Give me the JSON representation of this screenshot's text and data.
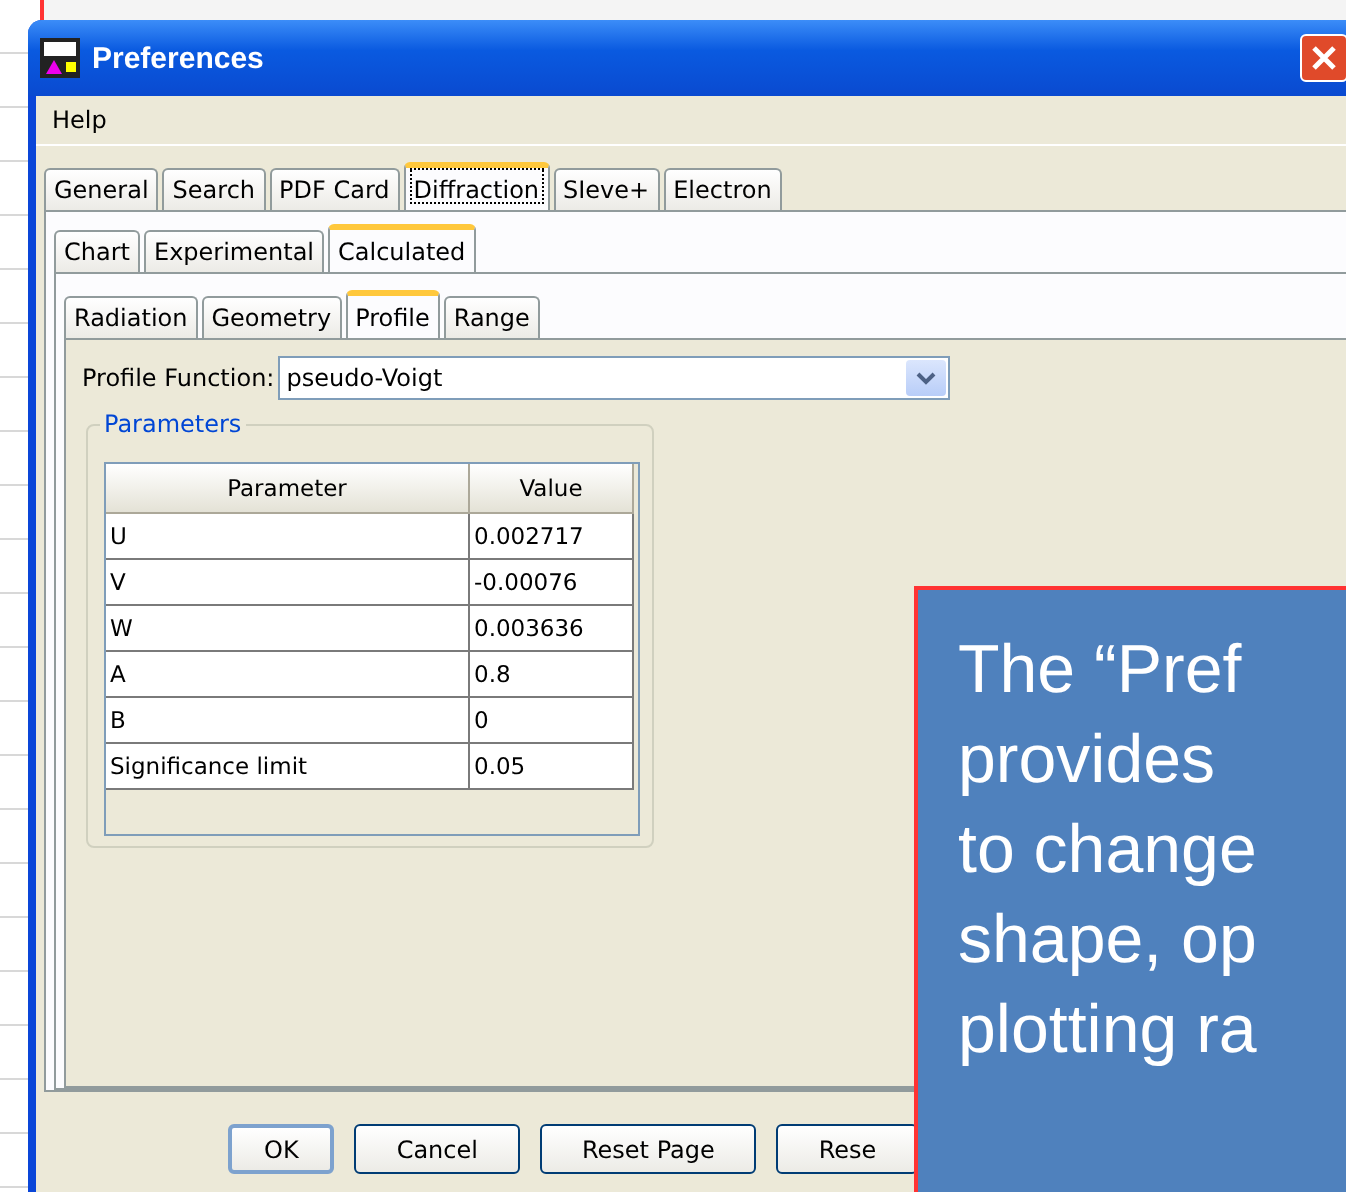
{
  "window": {
    "title": "Preferences"
  },
  "menu": [
    "Help"
  ],
  "tabs": [
    {
      "label": "General",
      "selected": false
    },
    {
      "label": "Search",
      "selected": false
    },
    {
      "label": "PDF Card",
      "selected": false
    },
    {
      "label": "Diffraction",
      "selected": true
    },
    {
      "label": "SIeve+",
      "selected": false
    },
    {
      "label": "Electron",
      "selected": false
    }
  ],
  "subtabs": [
    {
      "label": "Chart",
      "selected": false
    },
    {
      "label": "Experimental",
      "selected": false
    },
    {
      "label": "Calculated",
      "selected": true
    }
  ],
  "profile_tabs": [
    {
      "label": "Radiation",
      "selected": false
    },
    {
      "label": "Geometry",
      "selected": false
    },
    {
      "label": "Profile",
      "selected": true
    },
    {
      "label": "Range",
      "selected": false
    }
  ],
  "profile_function": {
    "label": "Profile Function:",
    "value": "pseudo-Voigt"
  },
  "parameters": {
    "title": "Parameters",
    "columns": [
      "Parameter",
      "Value"
    ],
    "rows": [
      [
        "U",
        "0.002717"
      ],
      [
        "V",
        "-0.00076"
      ],
      [
        "W",
        "0.003636"
      ],
      [
        "A",
        "0.8"
      ],
      [
        "B",
        "0"
      ],
      [
        "Significance limit",
        "0.05"
      ]
    ]
  },
  "buttons": [
    "OK",
    "Cancel",
    "Reset Page",
    "Rese"
  ],
  "callout": {
    "lines": [
      "The “Pref",
      "provides",
      "to change",
      "shape, op",
      "plotting ra"
    ]
  }
}
